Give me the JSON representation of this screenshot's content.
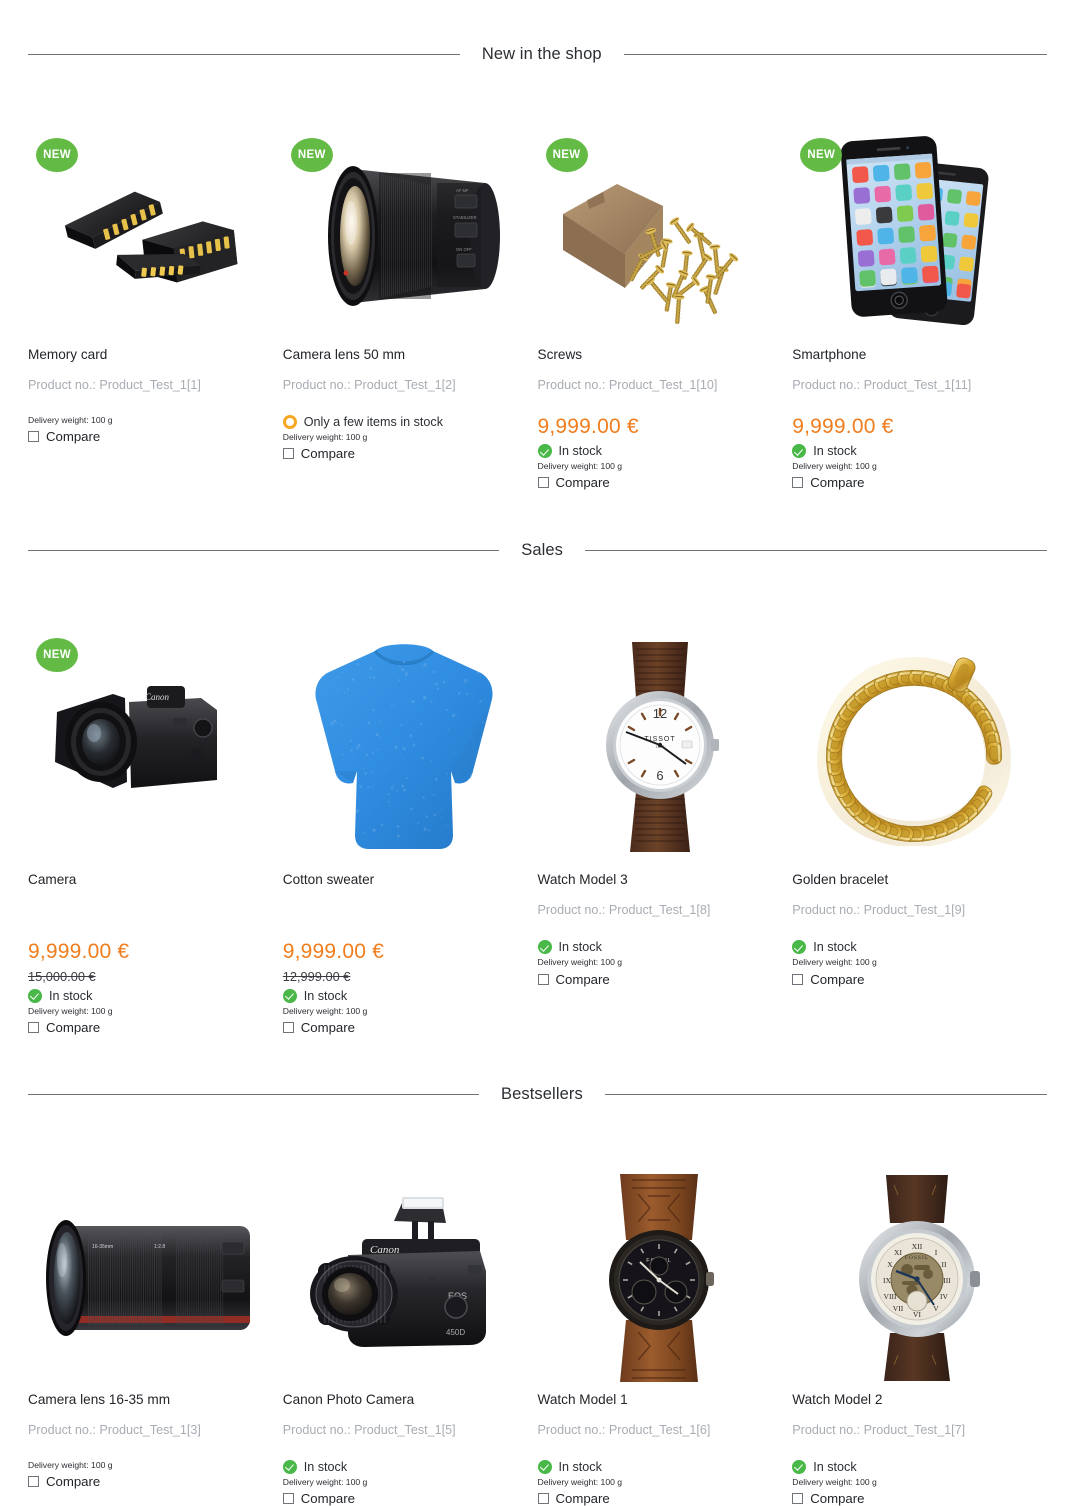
{
  "labels": {
    "product_no_prefix": "Product no.: ",
    "compare": "Compare",
    "in_stock": "In stock",
    "few_in_stock": "Only a few items in stock",
    "delivery_weight": "Delivery weight: 100 g",
    "new_badge": "NEW"
  },
  "colors": {
    "price": "#f07d1e",
    "badge_new": "#63bb46",
    "in_stock": "#49b849",
    "few_stock": "#f5a623",
    "muted_text": "#a8adb3",
    "rule": "#6e7277"
  },
  "sections": [
    {
      "title": "New in the shop",
      "products": [
        {
          "name": "Memory card",
          "product_no": "Product_Test_1[1]",
          "badge": "NEW",
          "price": "",
          "old_price": "",
          "stock": "",
          "weight": "Delivery weight: 100 g",
          "compare": "Compare",
          "image": "memory-card"
        },
        {
          "name": "Camera lens 50 mm",
          "product_no": "Product_Test_1[2]",
          "badge": "NEW",
          "price": "",
          "old_price": "",
          "stock": "Only a few items in stock",
          "weight": "Delivery weight: 100 g",
          "compare": "Compare",
          "image": "camera-lens-50mm"
        },
        {
          "name": "Screws",
          "product_no": "Product_Test_1[10]",
          "badge": "NEW",
          "price": "9,999.00 €",
          "old_price": "",
          "stock": "In stock",
          "weight": "Delivery weight: 100 g",
          "compare": "Compare",
          "image": "screws-box"
        },
        {
          "name": "Smartphone",
          "product_no": "Product_Test_1[11]",
          "badge": "NEW",
          "price": "9,999.00 €",
          "old_price": "",
          "stock": "In stock",
          "weight": "Delivery weight: 100 g",
          "compare": "Compare",
          "image": "smartphone"
        }
      ]
    },
    {
      "title": "Sales",
      "products": [
        {
          "name": "Camera",
          "product_no": "",
          "badge": "NEW",
          "price": "9,999.00 €",
          "old_price": "15,000.00 €",
          "stock": "In stock",
          "weight": "Delivery weight: 100 g",
          "compare": "Compare",
          "image": "dslr-camera"
        },
        {
          "name": "Cotton sweater",
          "product_no": "",
          "badge": "",
          "price": "9,999.00 €",
          "old_price": "12,999.00 €",
          "stock": "In stock",
          "weight": "Delivery weight: 100 g",
          "compare": "Compare",
          "image": "cotton-sweater"
        },
        {
          "name": "Watch Model 3",
          "product_no": "Product_Test_1[8]",
          "badge": "",
          "price": "",
          "old_price": "",
          "stock": "In stock",
          "weight": "Delivery weight: 100 g",
          "compare": "Compare",
          "image": "watch-silver-white"
        },
        {
          "name": "Golden bracelet",
          "product_no": "Product_Test_1[9]",
          "badge": "",
          "price": "",
          "old_price": "",
          "stock": "In stock",
          "weight": "Delivery weight: 100 g",
          "compare": "Compare",
          "image": "golden-bracelet"
        }
      ]
    },
    {
      "title": "Bestsellers",
      "products": [
        {
          "name": "Camera lens 16-35 mm",
          "product_no": "Product_Test_1[3]",
          "badge": "",
          "price": "",
          "old_price": "",
          "stock": "",
          "weight": "Delivery weight: 100 g",
          "compare": "Compare",
          "image": "camera-lens-1635"
        },
        {
          "name": "Canon Photo Camera",
          "product_no": "Product_Test_1[5]",
          "badge": "",
          "price": "",
          "old_price": "",
          "stock": "In stock",
          "weight": "Delivery weight: 100 g",
          "compare": "Compare",
          "image": "canon-photo-camera"
        },
        {
          "name": "Watch Model 1",
          "product_no": "Product_Test_1[6]",
          "badge": "",
          "price": "",
          "old_price": "",
          "stock": "In stock",
          "weight": "Delivery weight: 100 g",
          "compare": "Compare",
          "image": "watch-brown-cuff"
        },
        {
          "name": "Watch Model 2",
          "product_no": "Product_Test_1[7]",
          "badge": "",
          "price": "",
          "old_price": "",
          "stock": "In stock",
          "weight": "Delivery weight: 100 g",
          "compare": "Compare",
          "image": "watch-skeleton"
        }
      ]
    }
  ]
}
